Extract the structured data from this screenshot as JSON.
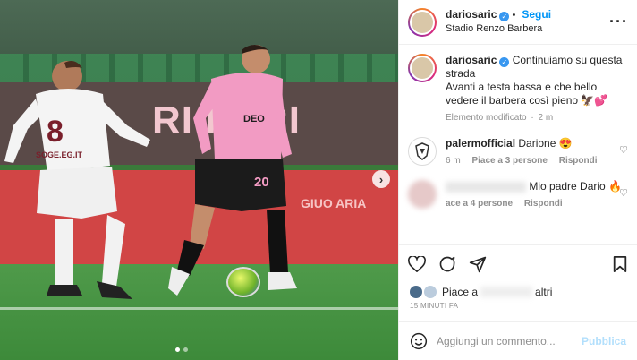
{
  "post": {
    "author": {
      "username": "dariosaric",
      "verified": true,
      "follow_separator": "•",
      "follow_label": "Segui",
      "location": "Stadio Renzo Barbera"
    },
    "photo": {
      "ad_banner_text": "RI PERI",
      "ad_board_text": "GIUO ARIA",
      "pink_player_number": "20",
      "pink_player_sponsor": "DEO",
      "white_player_number": "8",
      "white_player_sponsor": "SOGE.EG.IT"
    },
    "caption": {
      "username": "dariosaric",
      "text": "Continuiamo su questa strada\nAvanti a testa bassa e che bello vedere il barbera così pieno 🦅💕",
      "meta_edited": "Elemento modificato",
      "meta_separator": "·",
      "meta_time": "2 m"
    },
    "comments": [
      {
        "username": "palermofficial",
        "text": "Darione 😍",
        "time": "6 m",
        "likes": "Piace a 3 persone",
        "reply": "Rispondi"
      },
      {
        "username": "",
        "text": "Mio padre Dario 🔥",
        "time": "",
        "likes": "ace a 4 persone",
        "reply": "Rispondi"
      }
    ],
    "likes_summary": {
      "prefix": "Piace a",
      "suffix": "altri"
    },
    "timestamp": "15 MINUTI FA",
    "comment_input": {
      "placeholder": "Aggiungi un commento...",
      "publish_label": "Pubblica"
    },
    "colors": {
      "link_blue": "#0095f6",
      "verified_blue": "#3897f0",
      "publish_disabled": "#b2dffc",
      "meta_gray": "#8e8e8e"
    }
  }
}
